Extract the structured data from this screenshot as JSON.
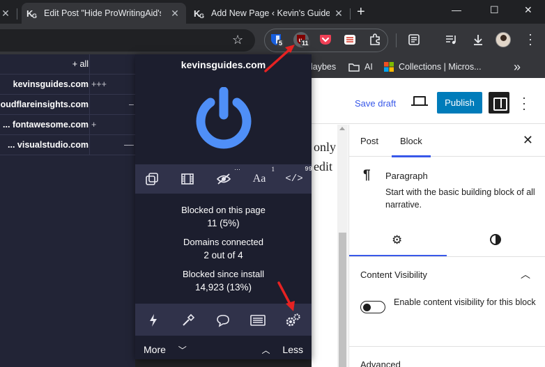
{
  "browser": {
    "tabs": [
      {
        "title": "Edit Post \"Hide ProWritingAid's",
        "active": true
      },
      {
        "title": "Add New Page ‹ Kevin's Guides",
        "active": false
      }
    ],
    "new_tab": "+",
    "window_controls": {
      "minimize": "—",
      "maximize": "☐",
      "close": "✕"
    },
    "extensions": [
      {
        "name": "bitwarden-icon",
        "badge": "5"
      },
      {
        "name": "ublock-origin-icon",
        "badge": "11"
      },
      {
        "name": "pocket-icon"
      },
      {
        "name": "todoist-icon"
      },
      {
        "name": "puzzle-icon"
      }
    ],
    "bookmarks": [
      {
        "label": "laybes"
      },
      {
        "label": "AI"
      },
      {
        "label": "Collections | Micros..."
      }
    ],
    "bookmarks_overflow": "»"
  },
  "blocked_list": {
    "header": "+ all",
    "rows": [
      {
        "domain": "kevinsguides.com",
        "mark": "+++"
      },
      {
        "domain": "oudflareinsights.com",
        "mark": "–"
      },
      {
        "domain": "... fontawesome.com",
        "mark": "+"
      },
      {
        "domain": "... visualstudio.com",
        "mark": "––"
      }
    ]
  },
  "popup": {
    "site": "kevinsguides.com",
    "tools": [
      {
        "name": "element-zapper-icon",
        "glyph": "⧉",
        "sup": ""
      },
      {
        "name": "media-icon",
        "glyph": "▦",
        "sup": ""
      },
      {
        "name": "cosmetic-filter-icon",
        "glyph": "👁",
        "sup": ""
      },
      {
        "name": "font-icon",
        "glyph": "Aa",
        "sup": "1"
      },
      {
        "name": "script-icon",
        "glyph": "</>",
        "sup": "99"
      }
    ],
    "stats": [
      {
        "label": "Blocked on this page",
        "value": "11 (5%)"
      },
      {
        "label": "Domains connected",
        "value": "2 out of 4"
      },
      {
        "label": "Blocked since install",
        "value": "14,923 (13%)"
      }
    ],
    "bottom_tools": [
      {
        "name": "lightning-icon",
        "glyph": "ϟ"
      },
      {
        "name": "eyedropper-icon",
        "glyph": "✎"
      },
      {
        "name": "comment-icon",
        "glyph": "💬"
      },
      {
        "name": "logger-icon",
        "glyph": "▤"
      },
      {
        "name": "settings-gears-icon",
        "glyph": "⚙"
      }
    ],
    "more": "More",
    "less": "Less",
    "accent": "#4f8ff7"
  },
  "wp": {
    "save_draft": "Save draft",
    "publish": "Publish",
    "content_lines": [
      "only",
      "edit"
    ],
    "sidebar": {
      "tabs": [
        "Post",
        "Block"
      ],
      "block_title": "Paragraph",
      "block_desc": "Start with the basic building block of all narrative.",
      "section_title": "Content Visibility",
      "toggle_label": "Enable content visibility for this block",
      "advanced": "Advanced"
    },
    "accent": "#3858e9"
  }
}
